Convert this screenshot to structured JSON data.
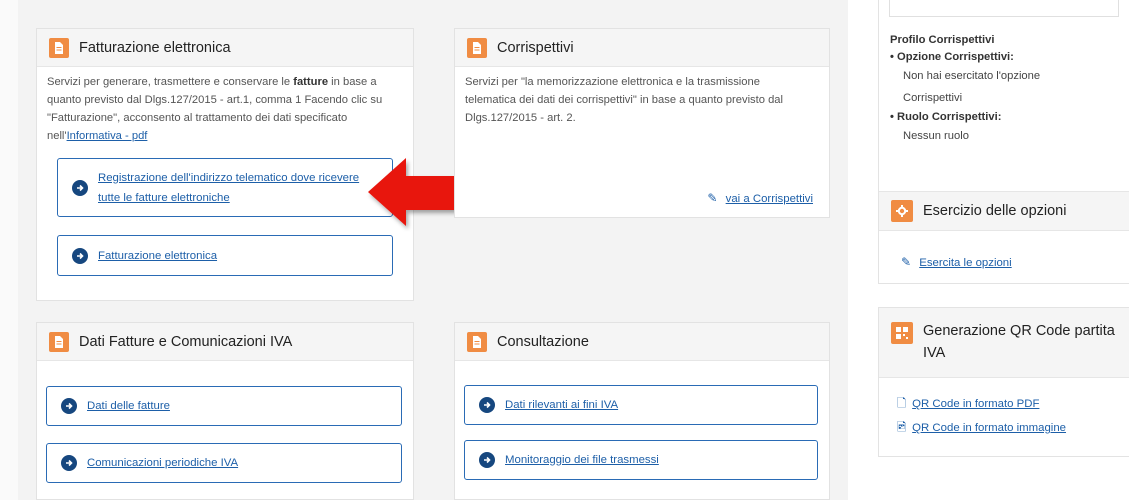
{
  "fatturazione": {
    "title": "Fatturazione elettronica",
    "desc_1": "Servizi per generare, trasmettere e conservare le ",
    "desc_bold": "fatture",
    "desc_2": " in base a quanto previsto dal Dlgs.127/2015 - art.1, comma 1 Facendo clic su \"Fatturazione\", acconsento al trattamento dei dati specificato nell'",
    "informativa_link": "Informativa - pdf",
    "btn_registrazione": "Registrazione dell'indirizzo telematico dove ricevere tutte le fatture elettroniche",
    "btn_fatturazione": "Fatturazione elettronica"
  },
  "corrispettivi": {
    "title": "Corrispettivi",
    "desc": "Servizi per \"la memorizzazione elettronica e la trasmissione telematica dei dati dei corrispettivi\" in base a quanto previsto dal Dlgs.127/2015 - art. 2.",
    "link": "vai a Corrispettivi"
  },
  "dati_fatture": {
    "title": "Dati Fatture e Comunicazioni IVA",
    "btn_dati": "Dati delle fatture",
    "btn_comunicazioni": "Comunicazioni periodiche IVA"
  },
  "consultazione": {
    "title": "Consultazione",
    "btn_dati_rilevanti": "Dati rilevanti ai fini IVA",
    "btn_monitoraggio": "Monitoraggio dei file trasmessi"
  },
  "sidebar": {
    "profilo_title": "Profilo Corrispettivi",
    "opzione_label": "Opzione Corrispettivi:",
    "opzione_value_1": "Non hai esercitato l'opzione",
    "opzione_value_2": "Corrispettivi",
    "ruolo_label": "Ruolo Corrispettivi:",
    "ruolo_value": "Nessun ruolo",
    "esercizio_title": "Esercizio delle opzioni",
    "esercita_link": "Esercita le opzioni",
    "qr_title": "Generazione QR Code partita IVA",
    "qr_pdf": "QR Code in formato PDF",
    "qr_img": "QR Code in formato immagine"
  },
  "colors": {
    "accent_orange": "#f08c43",
    "link_blue": "#1d5fa8",
    "arrow_red": "#e8140f"
  }
}
